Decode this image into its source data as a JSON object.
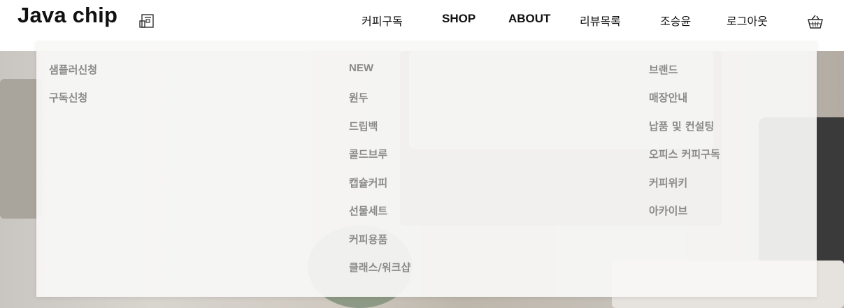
{
  "header": {
    "logo": "Java chip",
    "nav": [
      {
        "label": "커피구독",
        "bold": false
      },
      {
        "label": "SHOP",
        "bold": true
      },
      {
        "label": "ABOUT",
        "bold": true
      },
      {
        "label": "리뷰목록",
        "bold": false
      },
      {
        "label": "조승윤",
        "bold": false
      },
      {
        "label": "로그아웃",
        "bold": false
      }
    ],
    "icons": {
      "logo": "coffee-machine-icon",
      "cart": "basket-icon"
    }
  },
  "menu": {
    "columns": [
      {
        "items": [
          "샘플러신청",
          "구독신청"
        ]
      },
      {
        "items": [
          "NEW",
          "원두",
          "드립백",
          "콜드브루",
          "캡슐커피",
          "선물세트",
          "커피용품",
          "클래스/워크샵"
        ]
      },
      {
        "items": [
          "브랜드",
          "매장안내",
          "납품 및 컨설팅",
          "오피스 커피구독",
          "커피위키",
          "아카이브"
        ]
      }
    ]
  },
  "colors": {
    "text": "#111111",
    "menu_text": "#8a8a8a",
    "panel": "#f7f7f6"
  }
}
